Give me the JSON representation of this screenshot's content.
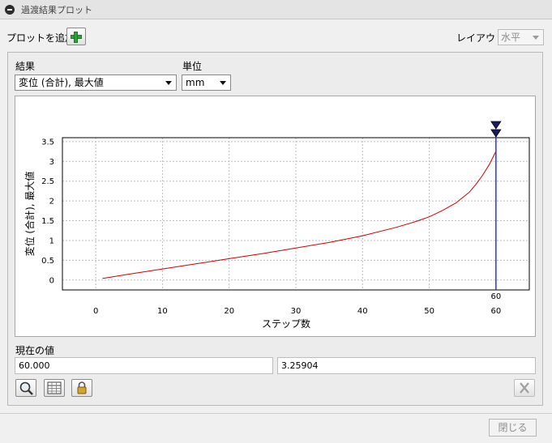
{
  "window": {
    "title": "過渡結果プロット"
  },
  "toolbar": {
    "add_plot_label": "プロットを追加",
    "layout_label": "レイアウト",
    "layout_value": "水平"
  },
  "panel": {
    "result_label": "結果",
    "result_value": "変位 (合計), 最大値",
    "unit_label": "単位",
    "unit_value": "mm",
    "current_value_label": "現在の値",
    "current_x": "60.000",
    "current_y": "3.25904"
  },
  "footer": {
    "close_label": "閉じる"
  },
  "colors": {
    "series": "#cc0000",
    "cursor": "#3333dd",
    "grid": "#bdbdbd"
  },
  "chart_data": {
    "type": "line",
    "xlabel": "ステップ数",
    "ylabel": "変位 (合計), 最大値",
    "xlim": [
      -5,
      65
    ],
    "ylim": [
      -0.25,
      3.6
    ],
    "xticks": [
      0,
      10,
      20,
      30,
      40,
      50,
      60
    ],
    "yticks": [
      0,
      0.5,
      1,
      1.5,
      2,
      2.5,
      3,
      3.5
    ],
    "ytick_labels": [
      "0",
      "0.5",
      "1",
      "1.5",
      "2",
      "2.5",
      "3",
      "3.5"
    ],
    "grid": true,
    "cursor_x": 60,
    "cursor_label": "60",
    "series": [
      {
        "x": [
          1,
          5,
          10,
          15,
          20,
          25,
          30,
          35,
          40,
          45,
          48,
          50,
          52,
          54,
          56,
          57,
          58,
          59,
          60
        ],
        "values": [
          0.04,
          0.15,
          0.28,
          0.41,
          0.54,
          0.67,
          0.81,
          0.95,
          1.12,
          1.33,
          1.48,
          1.6,
          1.76,
          1.95,
          2.22,
          2.42,
          2.65,
          2.92,
          3.26
        ]
      }
    ]
  }
}
